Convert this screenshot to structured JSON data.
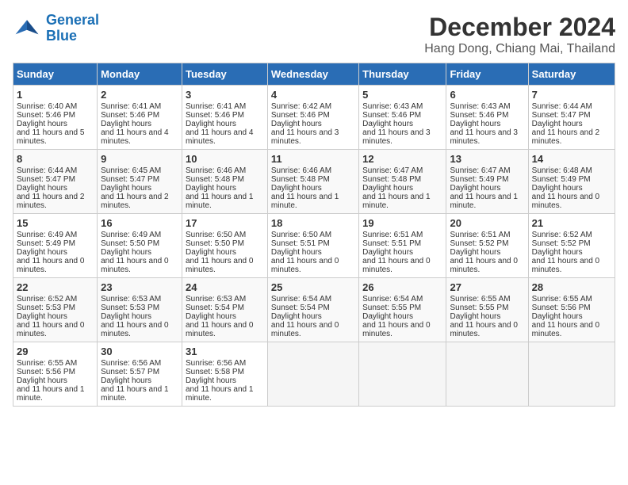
{
  "header": {
    "logo_line1": "General",
    "logo_line2": "Blue",
    "title": "December 2024",
    "subtitle": "Hang Dong, Chiang Mai, Thailand"
  },
  "columns": [
    "Sunday",
    "Monday",
    "Tuesday",
    "Wednesday",
    "Thursday",
    "Friday",
    "Saturday"
  ],
  "weeks": [
    [
      {
        "day": "1",
        "sunrise": "6:40 AM",
        "sunset": "5:46 PM",
        "daylight": "11 hours and 5 minutes."
      },
      {
        "day": "2",
        "sunrise": "6:41 AM",
        "sunset": "5:46 PM",
        "daylight": "11 hours and 4 minutes."
      },
      {
        "day": "3",
        "sunrise": "6:41 AM",
        "sunset": "5:46 PM",
        "daylight": "11 hours and 4 minutes."
      },
      {
        "day": "4",
        "sunrise": "6:42 AM",
        "sunset": "5:46 PM",
        "daylight": "11 hours and 3 minutes."
      },
      {
        "day": "5",
        "sunrise": "6:43 AM",
        "sunset": "5:46 PM",
        "daylight": "11 hours and 3 minutes."
      },
      {
        "day": "6",
        "sunrise": "6:43 AM",
        "sunset": "5:46 PM",
        "daylight": "11 hours and 3 minutes."
      },
      {
        "day": "7",
        "sunrise": "6:44 AM",
        "sunset": "5:47 PM",
        "daylight": "11 hours and 2 minutes."
      }
    ],
    [
      {
        "day": "8",
        "sunrise": "6:44 AM",
        "sunset": "5:47 PM",
        "daylight": "11 hours and 2 minutes."
      },
      {
        "day": "9",
        "sunrise": "6:45 AM",
        "sunset": "5:47 PM",
        "daylight": "11 hours and 2 minutes."
      },
      {
        "day": "10",
        "sunrise": "6:46 AM",
        "sunset": "5:48 PM",
        "daylight": "11 hours and 1 minute."
      },
      {
        "day": "11",
        "sunrise": "6:46 AM",
        "sunset": "5:48 PM",
        "daylight": "11 hours and 1 minute."
      },
      {
        "day": "12",
        "sunrise": "6:47 AM",
        "sunset": "5:48 PM",
        "daylight": "11 hours and 1 minute."
      },
      {
        "day": "13",
        "sunrise": "6:47 AM",
        "sunset": "5:49 PM",
        "daylight": "11 hours and 1 minute."
      },
      {
        "day": "14",
        "sunrise": "6:48 AM",
        "sunset": "5:49 PM",
        "daylight": "11 hours and 0 minutes."
      }
    ],
    [
      {
        "day": "15",
        "sunrise": "6:49 AM",
        "sunset": "5:49 PM",
        "daylight": "11 hours and 0 minutes."
      },
      {
        "day": "16",
        "sunrise": "6:49 AM",
        "sunset": "5:50 PM",
        "daylight": "11 hours and 0 minutes."
      },
      {
        "day": "17",
        "sunrise": "6:50 AM",
        "sunset": "5:50 PM",
        "daylight": "11 hours and 0 minutes."
      },
      {
        "day": "18",
        "sunrise": "6:50 AM",
        "sunset": "5:51 PM",
        "daylight": "11 hours and 0 minutes."
      },
      {
        "day": "19",
        "sunrise": "6:51 AM",
        "sunset": "5:51 PM",
        "daylight": "11 hours and 0 minutes."
      },
      {
        "day": "20",
        "sunrise": "6:51 AM",
        "sunset": "5:52 PM",
        "daylight": "11 hours and 0 minutes."
      },
      {
        "day": "21",
        "sunrise": "6:52 AM",
        "sunset": "5:52 PM",
        "daylight": "11 hours and 0 minutes."
      }
    ],
    [
      {
        "day": "22",
        "sunrise": "6:52 AM",
        "sunset": "5:53 PM",
        "daylight": "11 hours and 0 minutes."
      },
      {
        "day": "23",
        "sunrise": "6:53 AM",
        "sunset": "5:53 PM",
        "daylight": "11 hours and 0 minutes."
      },
      {
        "day": "24",
        "sunrise": "6:53 AM",
        "sunset": "5:54 PM",
        "daylight": "11 hours and 0 minutes."
      },
      {
        "day": "25",
        "sunrise": "6:54 AM",
        "sunset": "5:54 PM",
        "daylight": "11 hours and 0 minutes."
      },
      {
        "day": "26",
        "sunrise": "6:54 AM",
        "sunset": "5:55 PM",
        "daylight": "11 hours and 0 minutes."
      },
      {
        "day": "27",
        "sunrise": "6:55 AM",
        "sunset": "5:55 PM",
        "daylight": "11 hours and 0 minutes."
      },
      {
        "day": "28",
        "sunrise": "6:55 AM",
        "sunset": "5:56 PM",
        "daylight": "11 hours and 0 minutes."
      }
    ],
    [
      {
        "day": "29",
        "sunrise": "6:55 AM",
        "sunset": "5:56 PM",
        "daylight": "11 hours and 1 minute."
      },
      {
        "day": "30",
        "sunrise": "6:56 AM",
        "sunset": "5:57 PM",
        "daylight": "11 hours and 1 minute."
      },
      {
        "day": "31",
        "sunrise": "6:56 AM",
        "sunset": "5:58 PM",
        "daylight": "11 hours and 1 minute."
      },
      null,
      null,
      null,
      null
    ]
  ]
}
